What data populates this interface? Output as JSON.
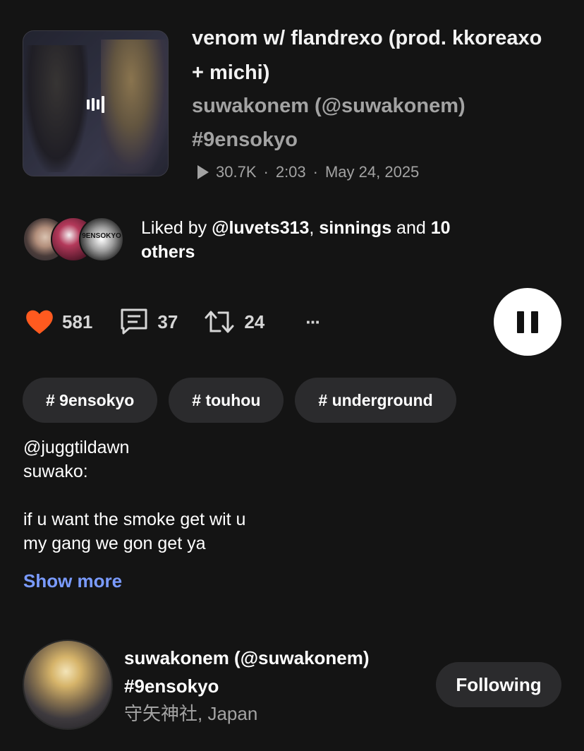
{
  "track": {
    "title": "venom w/ flandrexo (prod. kkoreaxo + michi)",
    "artist_line": "suwakonem (@suwakonem) #9ensokyo",
    "plays": "30.7K",
    "duration": "2:03",
    "date": "May 24, 2025",
    "separator": "·"
  },
  "likes": {
    "prefix": "Liked by ",
    "user1": "@luvets313",
    "comma": ", ",
    "user2": "sinnings",
    "and": " and ",
    "count": "10",
    "suffix": "others",
    "badge_text": "9ENSOKYO"
  },
  "stats": {
    "likes": "581",
    "comments": "37",
    "reposts": "24",
    "more": "···"
  },
  "tags": [
    "# 9ensokyo",
    "# touhou",
    "# underground"
  ],
  "description": {
    "lines": [
      "@juggtildawn",
      "suwako:",
      "",
      "if u want the smoke get wit u",
      "my gang we gon get ya"
    ],
    "show_more": "Show more"
  },
  "profile": {
    "name": "suwakonem (@suwakonem)",
    "subtitle": "#9ensokyo",
    "location": "守矢神社, Japan",
    "follow_label": "Following"
  },
  "colors": {
    "background": "#141414",
    "heart": "#ff5a1f",
    "link": "#7a9bff",
    "chip": "#2b2b2d",
    "muted": "#a3a3a3"
  }
}
